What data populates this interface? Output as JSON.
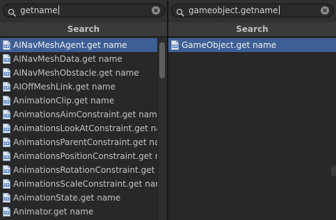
{
  "left_pane": {
    "search_value": "getname",
    "header": "Search",
    "items": [
      "AINavMeshAgent.get name",
      "AINavMeshData.get name",
      "AINavMeshObstacle.get name",
      "AIOffMeshLink.get name",
      "AnimationClip.get name",
      "AnimationsAimConstraint.get name",
      "AnimationsLookAtConstraint.get nar",
      "AnimationsParentConstraint.get nan",
      "AnimationsPositionConstraint.get na",
      "AnimationsRotationConstraint.get na",
      "AnimationsScaleConstraint.get nam",
      "AnimationState.get name",
      "Animator.get name"
    ],
    "selected_index": 0
  },
  "right_pane": {
    "search_value": "gameobject.getname",
    "header": "Search",
    "items": [
      "GameObject.get name"
    ],
    "selected_index": 0
  },
  "icons": {
    "search": "magnifier-icon",
    "clear": "clear-search-icon",
    "item": "cs-script-file-icon"
  },
  "colors": {
    "selection": "#3e5f96",
    "background": "#282828",
    "header": "#3a3a3a"
  }
}
